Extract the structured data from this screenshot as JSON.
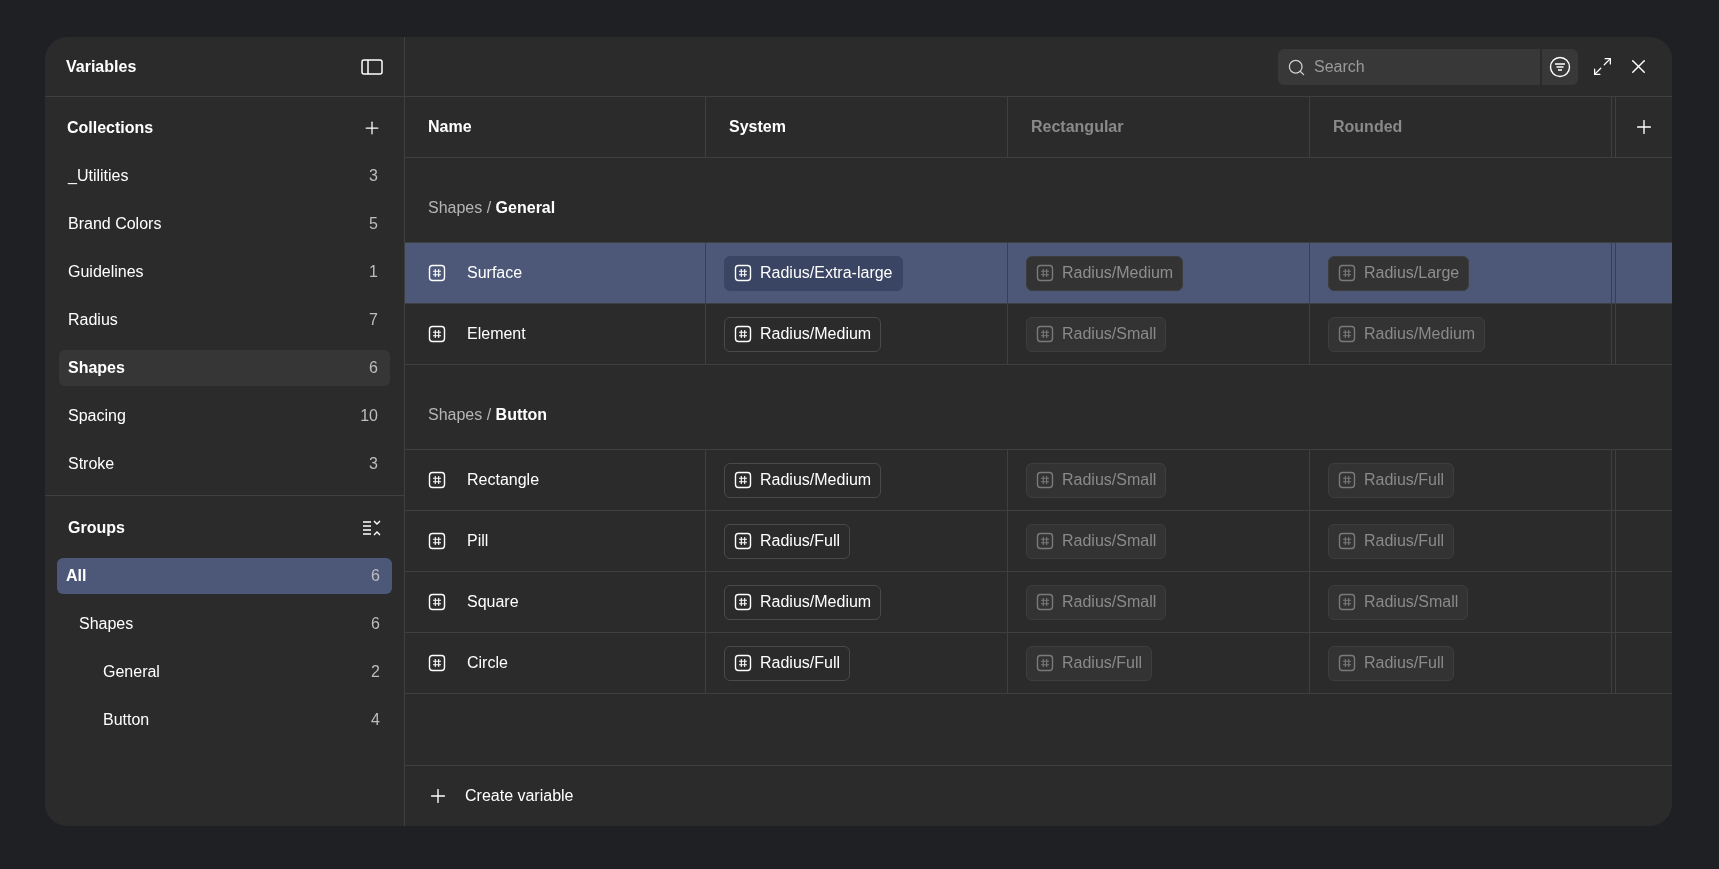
{
  "sidebar": {
    "title": "Variables",
    "collections": {
      "title": "Collections",
      "items": [
        {
          "label": "_Utilities",
          "count": "3",
          "selected": false
        },
        {
          "label": "Brand Colors",
          "count": "5",
          "selected": false
        },
        {
          "label": "Guidelines",
          "count": "1",
          "selected": false
        },
        {
          "label": "Radius",
          "count": "7",
          "selected": false
        },
        {
          "label": "Shapes",
          "count": "6",
          "selected": true
        },
        {
          "label": "Spacing",
          "count": "10",
          "selected": false
        },
        {
          "label": "Stroke",
          "count": "3",
          "selected": false
        }
      ]
    },
    "groups": {
      "title": "Groups",
      "items": [
        {
          "label": "All",
          "count": "6",
          "selected": true,
          "children": [
            {
              "label": "Shapes",
              "count": "6",
              "selected": false,
              "children": [
                {
                  "label": "General",
                  "count": "2",
                  "selected": false
                },
                {
                  "label": "Button",
                  "count": "4",
                  "selected": false
                }
              ]
            }
          ]
        }
      ]
    }
  },
  "search": {
    "placeholder": "Search"
  },
  "table": {
    "columns": [
      {
        "label": "Name",
        "active": true
      },
      {
        "label": "System",
        "active": true
      },
      {
        "label": "Rectangular",
        "active": false
      },
      {
        "label": "Rounded",
        "active": false
      }
    ],
    "groups": [
      {
        "title": "Shapes / **General**",
        "rows": [
          {
            "name": "Surface",
            "selected": true,
            "values": [
              "Radius/Extra-large",
              "Radius/Medium",
              "Radius/Large"
            ]
          },
          {
            "name": "Element",
            "selected": false,
            "values": [
              "Radius/Medium",
              "Radius/Small",
              "Radius/Medium"
            ]
          }
        ]
      },
      {
        "title": "Shapes / **Button**",
        "rows": [
          {
            "name": "Rectangle",
            "selected": false,
            "values": [
              "Radius/Medium",
              "Radius/Small",
              "Radius/Full"
            ]
          },
          {
            "name": "Pill",
            "selected": false,
            "values": [
              "Radius/Full",
              "Radius/Small",
              "Radius/Full"
            ]
          },
          {
            "name": "Square",
            "selected": false,
            "values": [
              "Radius/Medium",
              "Radius/Small",
              "Radius/Small"
            ]
          },
          {
            "name": "Circle",
            "selected": false,
            "values": [
              "Radius/Full",
              "Radius/Full",
              "Radius/Full"
            ]
          }
        ]
      }
    ]
  },
  "footer": {
    "action": "Create variable"
  }
}
